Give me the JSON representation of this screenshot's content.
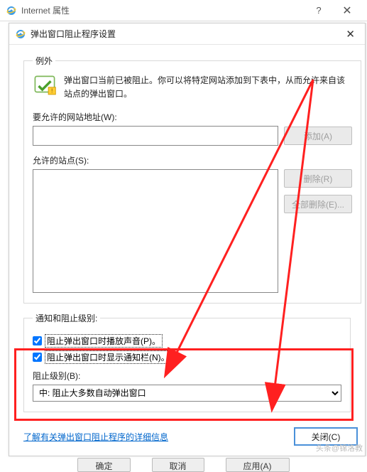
{
  "window": {
    "title": "Internet 属性",
    "help": "?",
    "close": "✕"
  },
  "dialog": {
    "title": "弹出窗口阻止程序设置",
    "close": "✕"
  },
  "fieldset_exceptions": {
    "legend": "例外",
    "intro": "弹出窗口当前已被阻止。你可以将特定网站添加到下表中，从而允许来自该站点的弹出窗口。",
    "addr_label": "要允许的网站地址(W):",
    "addr_value": "",
    "add_btn": "添加(A)",
    "allow_label": "允许的站点(S):",
    "remove_btn": "删除(R)",
    "remove_all_btn": "全部删除(E)..."
  },
  "fieldset_notify": {
    "legend": "通知和阻止级别:",
    "cb_sound": "阻止弹出窗口时播放声音(P)。",
    "cb_sound_checked": true,
    "cb_bar": "阻止弹出窗口时显示通知栏(N)。",
    "cb_bar_checked": true,
    "level_label": "阻止级别(B):",
    "level_value": "中: 阻止大多数自动弹出窗口"
  },
  "footer": {
    "link": "了解有关弹出窗口阻止程序的详细信息",
    "close_btn": "关闭(C)"
  },
  "parent_buttons": {
    "ok": "确定",
    "cancel": "取消",
    "apply": "应用(A)"
  },
  "watermark": "头条@锦洛教"
}
